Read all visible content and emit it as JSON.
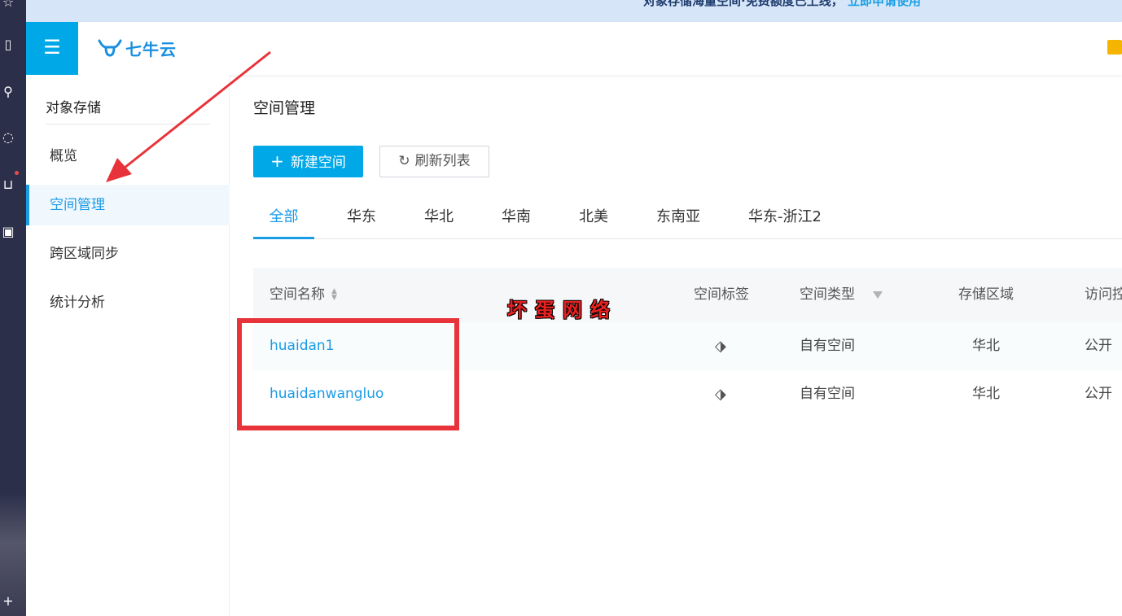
{
  "banner": {
    "text": "对象存储海量空间·免费额度已上线，",
    "link": "立即申请使用"
  },
  "header": {
    "brand": "七牛云"
  },
  "sidebar": {
    "title": "对象存储",
    "items": [
      {
        "label": "概览"
      },
      {
        "label": "空间管理"
      },
      {
        "label": "跨区域同步"
      },
      {
        "label": "统计分析"
      }
    ]
  },
  "main": {
    "title": "空间管理",
    "buttons": {
      "new_bucket": "新建空间",
      "refresh": "刷新列表"
    },
    "tabs": [
      "全部",
      "华东",
      "华北",
      "华南",
      "北美",
      "东南亚",
      "华东-浙江2"
    ],
    "table": {
      "headers": {
        "name": "空间名称",
        "tags": "空间标签",
        "type": "空间类型",
        "region": "存储区域",
        "access": "访问控"
      },
      "rows": [
        {
          "name": "huaidan1",
          "type": "自有空间",
          "region": "华北",
          "access": "公开"
        },
        {
          "name": "huaidanwangluo",
          "type": "自有空间",
          "region": "华北",
          "access": "公开"
        }
      ]
    }
  },
  "overlay": {
    "watermark": "坏蛋网络"
  },
  "colors": {
    "accent": "#00a8e8",
    "link": "#1a9be6",
    "annotation": "#e8333a"
  }
}
